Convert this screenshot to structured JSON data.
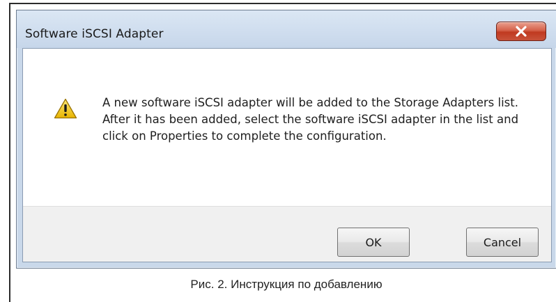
{
  "dialog": {
    "title": "Software iSCSI Adapter",
    "close_icon": "close-icon",
    "warning_icon": "warning-icon",
    "message": "A new software iSCSI adapter will be added to the Storage Adapters list. After it has been added, select the software iSCSI adapter in the list and click on Properties to complete the configuration.",
    "buttons": {
      "ok_label": "OK",
      "cancel_label": "Cancel"
    }
  },
  "caption": "Рис. 2. Инструкция по добавлению",
  "colors": {
    "close_button": "#c8523a",
    "warning_fill": "#f5c400",
    "titlebar": "#c9d8ea"
  }
}
